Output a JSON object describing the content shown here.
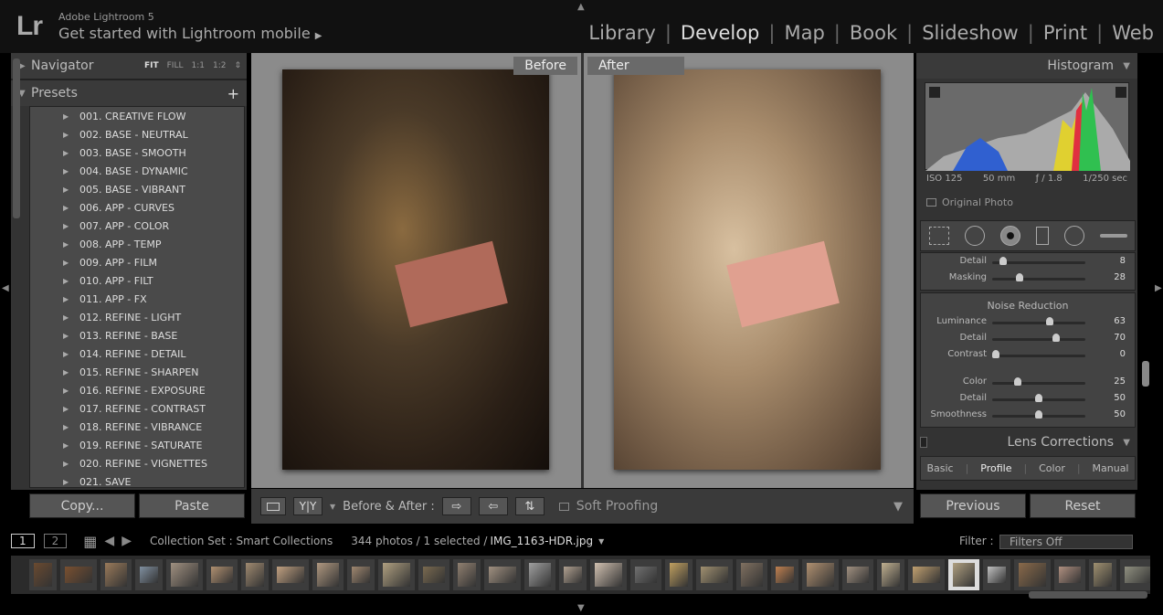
{
  "app": {
    "logo": "Lr",
    "name": "Adobe Lightroom 5",
    "mobile": "Get started with Lightroom mobile"
  },
  "modules": [
    "Library",
    "Develop",
    "Map",
    "Book",
    "Slideshow",
    "Print",
    "Web"
  ],
  "active_module": "Develop",
  "left": {
    "navigator": "Navigator",
    "nav_options": [
      "FIT",
      "FILL",
      "1:1",
      "1:2"
    ],
    "presets": "Presets",
    "items": [
      "001. CREATIVE FLOW",
      "002. BASE - NEUTRAL",
      "003. BASE - SMOOTH",
      "004. BASE - DYNAMIC",
      "005. BASE - VIBRANT",
      "006. APP - CURVES",
      "007. APP - COLOR",
      "008. APP - TEMP",
      "009. APP - FILM",
      "010. APP - FILT",
      "011. APP - FX",
      "012. REFINE - LIGHT",
      "013. REFINE - BASE",
      "014. REFINE - DETAIL",
      "015. REFINE - SHARPEN",
      "016. REFINE - EXPOSURE",
      "017. REFINE - CONTRAST",
      "018. REFINE - VIBRANCE",
      "019. REFINE - SATURATE",
      "020. REFINE - VIGNETTES",
      "021. SAVE"
    ],
    "copy": "Copy...",
    "paste": "Paste"
  },
  "center": {
    "before": "Before",
    "after": "After"
  },
  "toolbar": {
    "yy": "Y|Y",
    "before_after": "Before & After :",
    "soft_proofing": "Soft Proofing"
  },
  "right": {
    "histogram": "Histogram",
    "exif": {
      "iso": "ISO 125",
      "focal": "50 mm",
      "aperture": "ƒ / 1.8",
      "shutter": "1/250 sec"
    },
    "original_photo": "Original Photo",
    "sharpen": [
      {
        "label": "Detail",
        "value": 8,
        "pos": 0.08
      },
      {
        "label": "Masking",
        "value": 28,
        "pos": 0.28
      }
    ],
    "noise_title": "Noise Reduction",
    "noise": [
      {
        "label": "Luminance",
        "value": 63,
        "pos": 0.63
      },
      {
        "label": "Detail",
        "value": 70,
        "pos": 0.7
      },
      {
        "label": "Contrast",
        "value": 0,
        "pos": 0
      },
      {
        "label": "Color",
        "value": 25,
        "pos": 0.25
      },
      {
        "label": "Detail",
        "value": 50,
        "pos": 0.5
      },
      {
        "label": "Smoothness",
        "value": 50,
        "pos": 0.5
      }
    ],
    "lens": "Lens Corrections",
    "lens_tabs": [
      "Basic",
      "Profile",
      "Color",
      "Manual"
    ],
    "active_tab": "Profile",
    "previous": "Previous",
    "reset": "Reset"
  },
  "filmstrip": {
    "pages": [
      "1",
      "2"
    ],
    "source": "Collection Set : Smart Collections",
    "count": "344 photos / 1 selected /",
    "file": "IMG_1163-HDR.jpg",
    "filter_label": "Filter :",
    "filter_value": "Filters Off"
  }
}
